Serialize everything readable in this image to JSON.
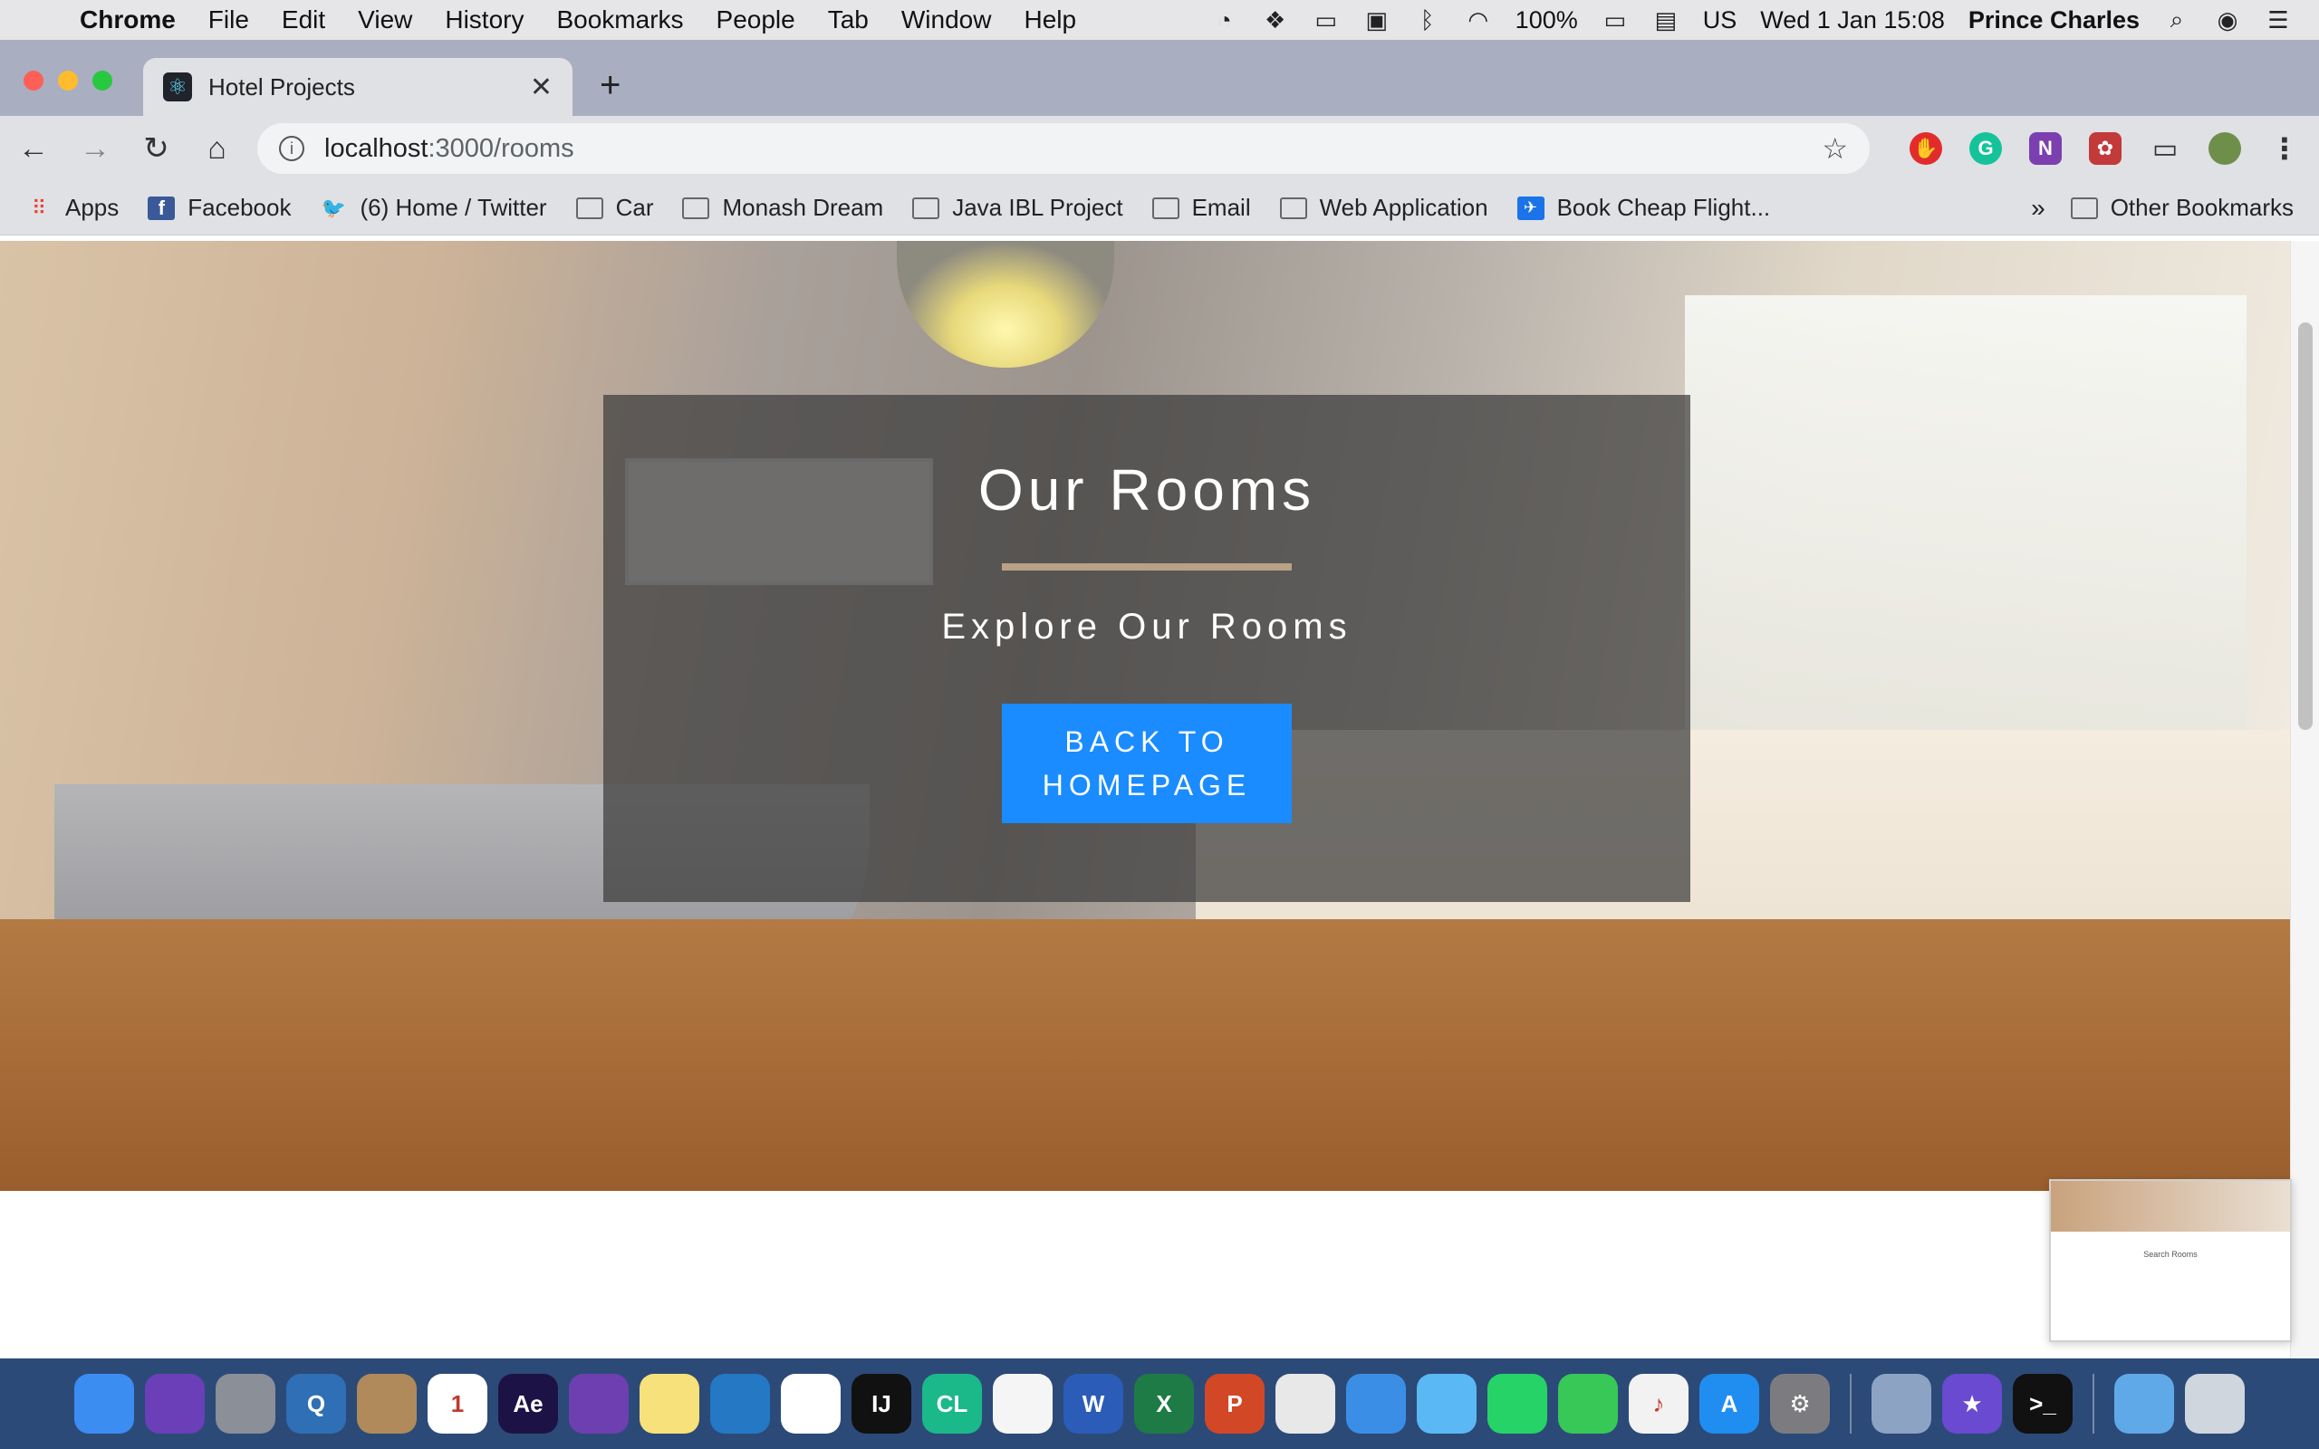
{
  "menubar": {
    "app_name": "Chrome",
    "menus": [
      "File",
      "Edit",
      "View",
      "History",
      "Bookmarks",
      "People",
      "Tab",
      "Window",
      "Help"
    ],
    "battery": "100%",
    "input_source": "US",
    "clock": "Wed 1 Jan  15:08",
    "user": "Prince Charles"
  },
  "browser": {
    "tab_title": "Hotel Projects",
    "url_host": "localhost",
    "url_rest": ":3000/rooms",
    "bookmarks": [
      {
        "label": "Apps",
        "icon": "apps-grid-icon"
      },
      {
        "label": "Facebook",
        "icon": "facebook-icon"
      },
      {
        "label": "(6) Home / Twitter",
        "icon": "twitter-icon"
      },
      {
        "label": "Car",
        "icon": "folder-icon"
      },
      {
        "label": "Monash Dream",
        "icon": "folder-icon"
      },
      {
        "label": "Java IBL Project",
        "icon": "folder-icon"
      },
      {
        "label": "Email",
        "icon": "folder-icon"
      },
      {
        "label": "Web Application",
        "icon": "folder-icon"
      },
      {
        "label": "Book Cheap Flight...",
        "icon": "flight-icon"
      }
    ],
    "other_bookmarks": "Other Bookmarks",
    "overflow": "»"
  },
  "page": {
    "hero_title": "Our Rooms",
    "hero_subtitle": "Explore Our Rooms",
    "hero_button": "BACK TO HOMEPAGE",
    "preview_label": "Search Rooms"
  },
  "colors": {
    "accent_button": "#1a8cff",
    "divider": "#b8a184",
    "overlay": "rgba(60,60,60,0.72)"
  },
  "dock": [
    {
      "name": "finder-icon",
      "color": "#3b8df2",
      "glyph": ""
    },
    {
      "name": "siri-icon",
      "color": "#6a3fb8",
      "glyph": ""
    },
    {
      "name": "launchpad-icon",
      "color": "#8a8f98",
      "glyph": ""
    },
    {
      "name": "quicktime-icon",
      "color": "#2f6fb6",
      "glyph": "Q"
    },
    {
      "name": "contacts-icon",
      "color": "#b08a5a",
      "glyph": ""
    },
    {
      "name": "calendar-icon",
      "color": "#ffffff",
      "glyph": "1"
    },
    {
      "name": "after-effects-icon",
      "color": "#1d1245",
      "glyph": "Ae"
    },
    {
      "name": "github-icon",
      "color": "#6e3fb0",
      "glyph": ""
    },
    {
      "name": "notes-icon",
      "color": "#f7e17a",
      "glyph": ""
    },
    {
      "name": "vscode-icon",
      "color": "#2478c4",
      "glyph": ""
    },
    {
      "name": "mongodb-icon",
      "color": "#ffffff",
      "glyph": ""
    },
    {
      "name": "intellij-icon",
      "color": "#111111",
      "glyph": "IJ"
    },
    {
      "name": "clion-icon",
      "color": "#1bb88a",
      "glyph": "CL"
    },
    {
      "name": "photos-icon",
      "color": "#f5f5f5",
      "glyph": ""
    },
    {
      "name": "word-icon",
      "color": "#2b5cb8",
      "glyph": "W"
    },
    {
      "name": "excel-icon",
      "color": "#1e7b45",
      "glyph": "X"
    },
    {
      "name": "powerpoint-icon",
      "color": "#d24726",
      "glyph": "P"
    },
    {
      "name": "chrome-icon",
      "color": "#e8e8e8",
      "glyph": ""
    },
    {
      "name": "safari-icon",
      "color": "#3a8ee6",
      "glyph": ""
    },
    {
      "name": "messages-icon",
      "color": "#5ab8f5",
      "glyph": ""
    },
    {
      "name": "whatsapp-icon",
      "color": "#25d366",
      "glyph": ""
    },
    {
      "name": "facetime-icon",
      "color": "#37c858",
      "glyph": ""
    },
    {
      "name": "itunes-icon",
      "color": "#f2f2f2",
      "glyph": "♪"
    },
    {
      "name": "app-store-icon",
      "color": "#1f8ef0",
      "glyph": "A"
    },
    {
      "name": "system-preferences-icon",
      "color": "#7c7c80",
      "glyph": "⚙"
    },
    {
      "name": "preview-icon",
      "color": "#8da3c4",
      "glyph": ""
    },
    {
      "name": "imovie-icon",
      "color": "#6a4ad1",
      "glyph": "★"
    },
    {
      "name": "terminal-icon",
      "color": "#111111",
      "glyph": ">_"
    },
    {
      "name": "downloads-folder-icon",
      "color": "#5fa9e8",
      "glyph": ""
    },
    {
      "name": "trash-icon",
      "color": "#cfd6de",
      "glyph": ""
    }
  ]
}
